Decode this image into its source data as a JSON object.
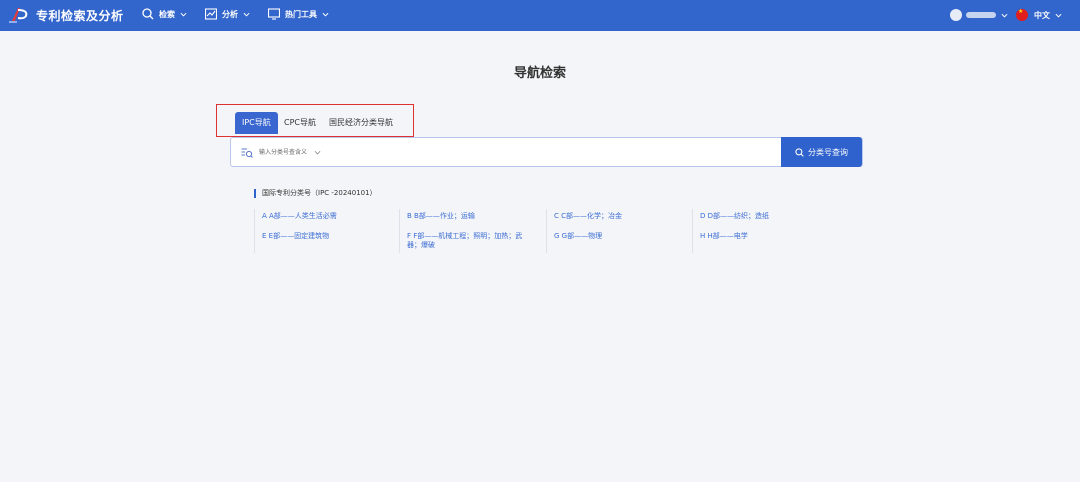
{
  "header": {
    "app_title": "专利检索及分析",
    "nav": [
      {
        "label": "检索"
      },
      {
        "label": "分析"
      },
      {
        "label": "热门工具"
      }
    ],
    "language": "中文"
  },
  "page": {
    "title": "导航检索"
  },
  "tabs": [
    {
      "label": "IPC导航",
      "active": true
    },
    {
      "label": "CPC导航",
      "active": false
    },
    {
      "label": "国民经济分类导航",
      "active": false
    }
  ],
  "search": {
    "placeholder": "输入分类号查含义",
    "button_label": "分类号查询"
  },
  "classification": {
    "header": "国际专利分类号（IPC -20240101）",
    "items": [
      {
        "label": "A A部——人类生活必需"
      },
      {
        "label": "B B部——作业；运输"
      },
      {
        "label": "C C部——化学；冶金"
      },
      {
        "label": "D D部——纺织；造纸"
      },
      {
        "label": "E E部——固定建筑物"
      },
      {
        "label": "F F部——机械工程；照明；加热；武器；爆破"
      },
      {
        "label": "G G部——物理"
      },
      {
        "label": "H H部——电学"
      }
    ]
  },
  "colors": {
    "topbar": "#3366cc",
    "accent": "#2f62cc",
    "link": "#3a6cd4",
    "highlight": "#e03131"
  }
}
